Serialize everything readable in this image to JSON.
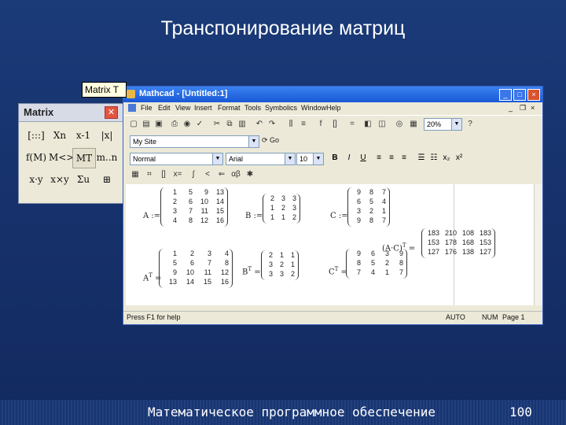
{
  "slide": {
    "title": "Транспонирование матриц",
    "footer": "Математическое программное обеспечение",
    "page": "100"
  },
  "palette": {
    "title": "Matrix",
    "close": "✕",
    "buttons": [
      "[:::]",
      "Xn",
      "x-1",
      "|x|",
      "f(M)",
      "M<>",
      "MT",
      "m..n",
      "x·y",
      "x×y",
      "Σu",
      "⊞"
    ],
    "tooltip": "Matrix T"
  },
  "app": {
    "title": "Mathcad - [Untitled:1]",
    "menu": [
      "File",
      "Edit",
      "View",
      "Insert",
      "Format",
      "Tools",
      "Symbolics",
      "Window",
      "Help"
    ],
    "zoom": "20%",
    "resource_combo": "My Site",
    "go": "Go",
    "style_combo": "Normal",
    "font_combo": "Arial",
    "size_combo": "10",
    "bold": "B",
    "italic": "I",
    "underline": "U",
    "status": {
      "help": "Press F1 for help",
      "mode": "AUTO",
      "num": "NUM",
      "page": "Page 1"
    }
  },
  "worksheet": {
    "A": {
      "label": "A :=",
      "rows": [
        [
          "1",
          "5",
          "9",
          "13"
        ],
        [
          "2",
          "6",
          "10",
          "14"
        ],
        [
          "3",
          "7",
          "11",
          "15"
        ],
        [
          "4",
          "8",
          "12",
          "16"
        ]
      ]
    },
    "B": {
      "label": "B :=",
      "rows": [
        [
          "2",
          "3",
          "3"
        ],
        [
          "1",
          "2",
          "3"
        ],
        [
          "1",
          "1",
          "2"
        ]
      ]
    },
    "C": {
      "label": "C :=",
      "rows": [
        [
          "9",
          "8",
          "7"
        ],
        [
          "6",
          "5",
          "4"
        ],
        [
          "3",
          "2",
          "1"
        ],
        [
          "9",
          "8",
          "7"
        ]
      ]
    },
    "AT": {
      "label": "A",
      "sup": "T",
      "eq": "=",
      "rows": [
        [
          "1",
          "2",
          "3",
          "4"
        ],
        [
          "5",
          "6",
          "7",
          "8"
        ],
        [
          "9",
          "10",
          "11",
          "12"
        ],
        [
          "13",
          "14",
          "15",
          "16"
        ]
      ]
    },
    "BT": {
      "label": "B",
      "sup": "T",
      "eq": "=",
      "rows": [
        [
          "2",
          "1",
          "1"
        ],
        [
          "3",
          "2",
          "1"
        ],
        [
          "3",
          "3",
          "2"
        ]
      ]
    },
    "CT": {
      "label": "C",
      "sup": "T",
      "eq": "=",
      "rows": [
        [
          "9",
          "6",
          "3",
          "9"
        ],
        [
          "8",
          "5",
          "2",
          "8"
        ],
        [
          "7",
          "4",
          "1",
          "7"
        ]
      ]
    },
    "ACT": {
      "label": "(A·C)",
      "sup": "T",
      "eq": "=",
      "rows": [
        [
          "183",
          "210",
          "108",
          "183"
        ],
        [
          "153",
          "178",
          "168",
          "153"
        ],
        [
          "127",
          "176",
          "138",
          "127"
        ]
      ]
    }
  }
}
